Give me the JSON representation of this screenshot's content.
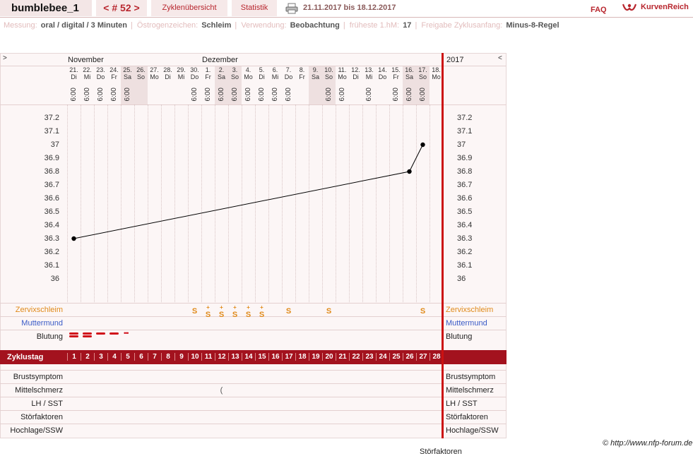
{
  "header": {
    "user": "bumblebee_1",
    "cycle_label": "< # 52 >",
    "tab_overview": "Zyklenübersicht",
    "tab_stats": "Statistik",
    "date_range": "21.11.2017 bis 18.12.2017",
    "faq": "FAQ",
    "brand": "KurvenReich"
  },
  "meta": {
    "messung_label": "Messung:",
    "messung": "oral / digital / 3 Minuten",
    "oestro_label": "Östrogenzeichen:",
    "oestro": "Schleim",
    "verwendung_label": "Verwendung:",
    "verwendung": "Beobachtung",
    "hm_label": "früheste 1.hM:",
    "hm": "17",
    "freigabe_label": "Freigabe Zyklusanfang:",
    "freigabe": "Minus-8-Regel"
  },
  "chart_header": {
    "left_toggle": ">",
    "right_toggle": "<",
    "month1": "November",
    "month2": "Dezember",
    "year": "2017"
  },
  "days": [
    {
      "n": "21.",
      "d": "Di",
      "t": "6:00",
      "we": false
    },
    {
      "n": "22.",
      "d": "Mi",
      "t": "6:00",
      "we": false
    },
    {
      "n": "23.",
      "d": "Do",
      "t": "6:00",
      "we": false
    },
    {
      "n": "24.",
      "d": "Fr",
      "t": "6:00",
      "we": false
    },
    {
      "n": "25.",
      "d": "Sa",
      "t": "6:00",
      "we": true
    },
    {
      "n": "26.",
      "d": "So",
      "t": "",
      "we": true
    },
    {
      "n": "27.",
      "d": "Mo",
      "t": "",
      "we": false
    },
    {
      "n": "28.",
      "d": "Di",
      "t": "",
      "we": false
    },
    {
      "n": "29.",
      "d": "Mi",
      "t": "",
      "we": false
    },
    {
      "n": "30.",
      "d": "Do",
      "t": "6:00",
      "we": false
    },
    {
      "n": "1.",
      "d": "Fr",
      "t": "6:00",
      "we": false
    },
    {
      "n": "2.",
      "d": "Sa",
      "t": "6:00",
      "we": true
    },
    {
      "n": "3.",
      "d": "So",
      "t": "6:00",
      "we": true
    },
    {
      "n": "4.",
      "d": "Mo",
      "t": "6:00",
      "we": false
    },
    {
      "n": "5.",
      "d": "Di",
      "t": "6:00",
      "we": false
    },
    {
      "n": "6.",
      "d": "Mi",
      "t": "6:00",
      "we": false
    },
    {
      "n": "7.",
      "d": "Do",
      "t": "6:00",
      "we": false
    },
    {
      "n": "8.",
      "d": "Fr",
      "t": "",
      "we": false
    },
    {
      "n": "9.",
      "d": "Sa",
      "t": "",
      "we": true
    },
    {
      "n": "10.",
      "d": "So",
      "t": "6:00",
      "we": true
    },
    {
      "n": "11.",
      "d": "Mo",
      "t": "6:00",
      "we": false
    },
    {
      "n": "12.",
      "d": "Di",
      "t": "",
      "we": false
    },
    {
      "n": "13.",
      "d": "Mi",
      "t": "6:00",
      "we": false
    },
    {
      "n": "14.",
      "d": "Do",
      "t": "",
      "we": false
    },
    {
      "n": "15.",
      "d": "Fr",
      "t": "6:00",
      "we": false
    },
    {
      "n": "16.",
      "d": "Sa",
      "t": "6:00",
      "we": true
    },
    {
      "n": "17.",
      "d": "So",
      "t": "6:00",
      "we": true
    },
    {
      "n": "18.",
      "d": "Mo",
      "t": "",
      "we": false
    }
  ],
  "temp_ticks": [
    "37.2",
    "37.1",
    "37",
    "36.9",
    "36.8",
    "36.7",
    "36.6",
    "36.5",
    "36.4",
    "36.3",
    "36.2",
    "36.1",
    "36"
  ],
  "chart_data": {
    "type": "line",
    "y_range": [
      36.0,
      37.2
    ],
    "points": [
      {
        "cycle_day": 1,
        "temp": 36.3
      },
      {
        "cycle_day": 26,
        "temp": 36.8
      },
      {
        "cycle_day": 27,
        "temp": 37.0
      }
    ]
  },
  "rows": {
    "zervix": "Zervixschleim",
    "muttermund": "Muttermund",
    "blutung": "Blutung",
    "zyklustag": "Zyklustag",
    "brust": "Brustsymptom",
    "mittel": "Mittelschmerz",
    "lh": "LH / SST",
    "stoer": "Störfaktoren",
    "hoch": "Hochlage/SSW"
  },
  "zervix_marks": [
    {
      "cycle_day": 10,
      "sym": "S"
    },
    {
      "cycle_day": 11,
      "sym": "S+"
    },
    {
      "cycle_day": 12,
      "sym": "S+"
    },
    {
      "cycle_day": 13,
      "sym": "S+"
    },
    {
      "cycle_day": 14,
      "sym": "S+"
    },
    {
      "cycle_day": 15,
      "sym": "S+"
    },
    {
      "cycle_day": 17,
      "sym": "S"
    },
    {
      "cycle_day": 20,
      "sym": "S"
    },
    {
      "cycle_day": 27,
      "sym": "S"
    }
  ],
  "bleeding": [
    {
      "cycle_day": 1,
      "level": "heavy"
    },
    {
      "cycle_day": 2,
      "level": "heavy"
    },
    {
      "cycle_day": 3,
      "level": "medium"
    },
    {
      "cycle_day": 4,
      "level": "medium"
    },
    {
      "cycle_day": 5,
      "level": "spotting"
    }
  ],
  "mittelschmerz_mark": {
    "cycle_day": 12,
    "sym": "("
  },
  "cycle_days": [
    "1",
    "2",
    "3",
    "4",
    "5",
    "6",
    "7",
    "8",
    "9",
    "10",
    "11",
    "12",
    "13",
    "14",
    "15",
    "16",
    "17",
    "18",
    "19",
    "20",
    "21",
    "22",
    "23",
    "24",
    "25",
    "26",
    "27",
    "28"
  ],
  "footer": {
    "copyright": "© http://www.nfp-forum.de",
    "bottom": "Störfaktoren"
  },
  "colors": {
    "accent": "#a3121e",
    "zervix": "#e08a1a",
    "muttermund": "#3a5bc7",
    "redline": "#cc1111"
  }
}
